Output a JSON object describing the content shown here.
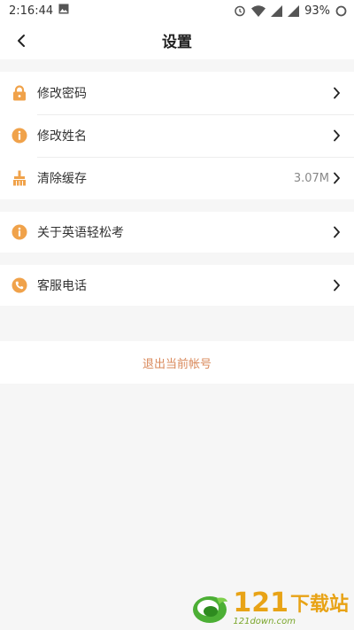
{
  "status": {
    "time": "2:16:44",
    "battery": "93%"
  },
  "header": {
    "title": "设置"
  },
  "group1": [
    {
      "label": "修改密码",
      "value": "",
      "icon": "lock-icon"
    },
    {
      "label": "修改姓名",
      "value": "",
      "icon": "info-icon"
    },
    {
      "label": "清除缓存",
      "value": "3.07M",
      "icon": "broom-icon"
    }
  ],
  "group2": [
    {
      "label": "关于英语轻松考",
      "icon": "info-icon"
    }
  ],
  "group3": [
    {
      "label": "客服电话",
      "icon": "phone-icon"
    }
  ],
  "logout": {
    "label": "退出当前帐号"
  },
  "watermark": {
    "number": "121",
    "cn": "下载站",
    "site": "121down.com"
  },
  "colors": {
    "accent": "#f0a24a",
    "logout": "#d9885a",
    "background": "#f6f6f6"
  }
}
